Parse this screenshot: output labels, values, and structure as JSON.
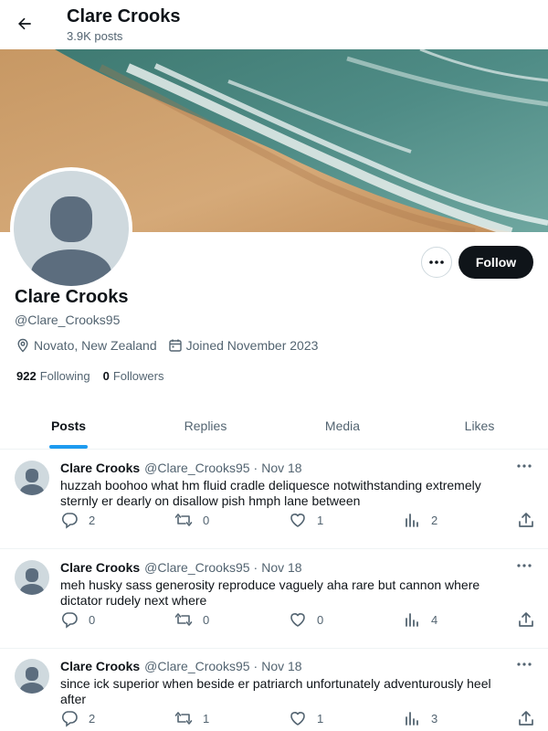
{
  "header": {
    "name": "Clare Crooks",
    "post_count": "3.9K posts",
    "back_icon": "arrow-left-icon"
  },
  "profile": {
    "name": "Clare Crooks",
    "handle": "@Clare_Crooks95",
    "location": "Novato, New Zealand",
    "joined": "Joined November 2023",
    "following_count": "922",
    "following_label": "Following",
    "followers_count": "0",
    "followers_label": "Followers",
    "follow_button": "Follow",
    "more_icon": "ellipsis-icon"
  },
  "tabs": [
    {
      "label": "Posts",
      "active": true
    },
    {
      "label": "Replies",
      "active": false
    },
    {
      "label": "Media",
      "active": false
    },
    {
      "label": "Likes",
      "active": false
    }
  ],
  "posts": [
    {
      "name": "Clare Crooks",
      "handle": "@Clare_Crooks95",
      "separator": "·",
      "date": "Nov 18",
      "text": "huzzah boohoo what hm fluid cradle deliquesce notwithstanding extremely sternly er dearly on disallow pish hmph lane between",
      "replies": "2",
      "reposts": "0",
      "likes": "1",
      "views": "2"
    },
    {
      "name": "Clare Crooks",
      "handle": "@Clare_Crooks95",
      "separator": "·",
      "date": "Nov 18",
      "text": "meh husky sass generosity reproduce vaguely aha rare but cannon where dictator rudely next where",
      "replies": "0",
      "reposts": "0",
      "likes": "0",
      "views": "4"
    },
    {
      "name": "Clare Crooks",
      "handle": "@Clare_Crooks95",
      "separator": "·",
      "date": "Nov 18",
      "text": "since ick superior when beside er patriarch unfortunately adventurously heel after",
      "replies": "2",
      "reposts": "1",
      "likes": "1",
      "views": "3"
    }
  ],
  "colors": {
    "accent": "#1d9bf0",
    "text_primary": "#0f1419",
    "text_secondary": "#536471",
    "follow_bg": "#0f1419"
  }
}
